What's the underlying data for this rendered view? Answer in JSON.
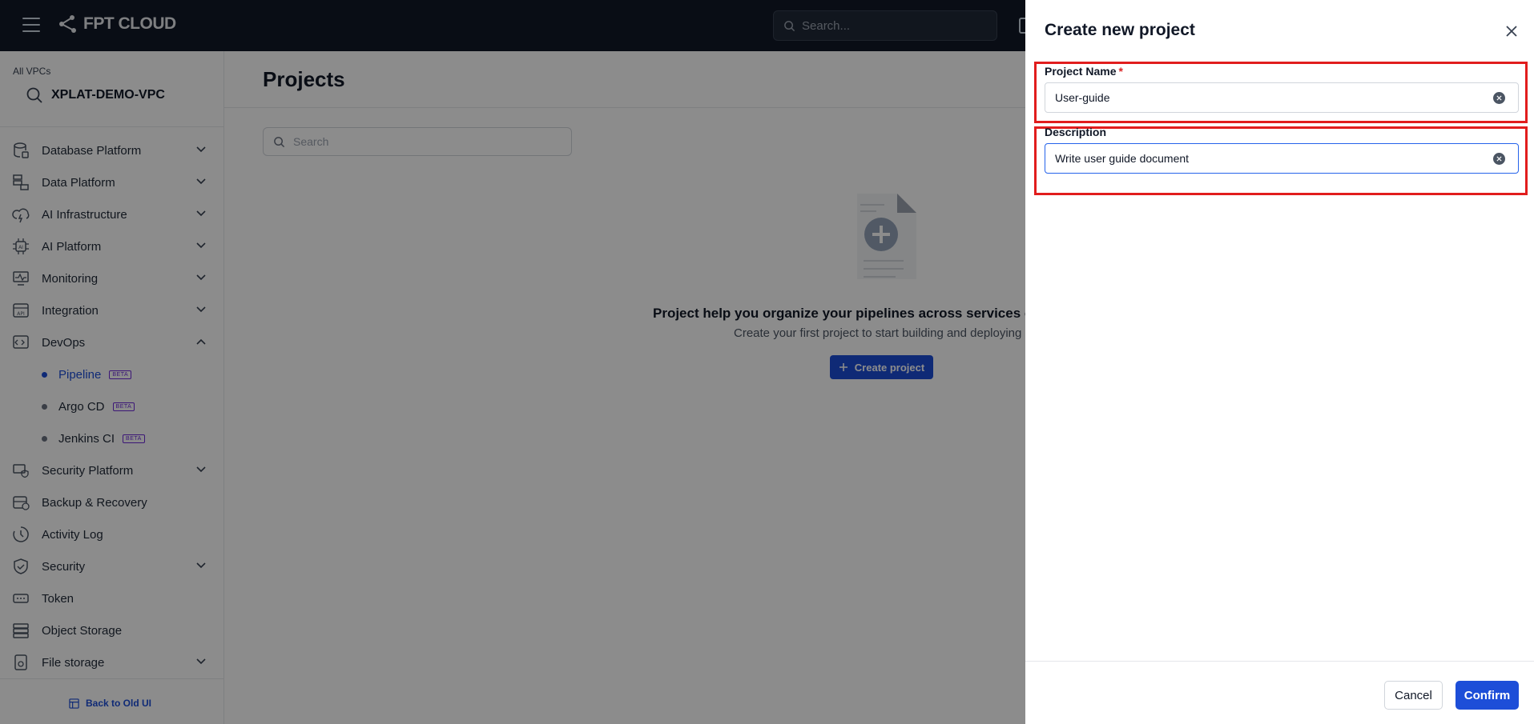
{
  "app": {
    "logo_text": "FPT CLOUD"
  },
  "topbar": {
    "search_placeholder": "Search..."
  },
  "sidebar": {
    "vpc_label": "All VPCs",
    "vpc_name": "XPLAT-DEMO-VPC",
    "items": [
      {
        "label": "Database Platform",
        "icon": "database-icon",
        "chevron": "down"
      },
      {
        "label": "Data Platform",
        "icon": "data-platform-icon",
        "chevron": "down"
      },
      {
        "label": "AI Infrastructure",
        "icon": "ai-infrastructure-icon",
        "chevron": "down"
      },
      {
        "label": "AI Platform",
        "icon": "ai-chip-icon",
        "chevron": "down"
      },
      {
        "label": "Monitoring",
        "icon": "monitor-icon",
        "chevron": "down"
      },
      {
        "label": "Integration",
        "icon": "api-icon",
        "chevron": "down"
      },
      {
        "label": "DevOps",
        "icon": "devops-icon",
        "chevron": "up"
      }
    ],
    "devops_children": [
      {
        "label": "Pipeline",
        "badge": "BETA",
        "active": true
      },
      {
        "label": "Argo CD",
        "badge": "BETA",
        "active": false
      },
      {
        "label": "Jenkins CI",
        "badge": "BETA",
        "active": false
      }
    ],
    "items_after": [
      {
        "label": "Security Platform",
        "icon": "security-platform-icon",
        "chevron": "down"
      },
      {
        "label": "Backup & Recovery",
        "icon": "backup-icon",
        "chevron": ""
      },
      {
        "label": "Activity Log",
        "icon": "clock-icon",
        "chevron": ""
      },
      {
        "label": "Security",
        "icon": "shield-icon",
        "chevron": "down"
      },
      {
        "label": "Token",
        "icon": "token-icon",
        "chevron": ""
      },
      {
        "label": "Object Storage",
        "icon": "object-storage-icon",
        "chevron": ""
      },
      {
        "label": "File storage",
        "icon": "file-storage-icon",
        "chevron": "down"
      }
    ],
    "back_link": "Back to Old UI"
  },
  "main": {
    "title": "Projects",
    "search_placeholder": "Search",
    "empty_title": "Project help you organize your pipelines across services or e",
    "empty_subtitle": "Create your first project to start building and deploying",
    "create_button": "Create project"
  },
  "drawer": {
    "title": "Create new project",
    "project_name_label": "Project Name",
    "required_mark": "*",
    "project_name_value": "User-guide",
    "description_label": "Description",
    "description_value": "Write user guide document",
    "cancel_label": "Cancel",
    "confirm_label": "Confirm"
  },
  "colors": {
    "accent": "#1d4ed8",
    "highlight": "#e11d1d",
    "topbar": "#111827"
  }
}
